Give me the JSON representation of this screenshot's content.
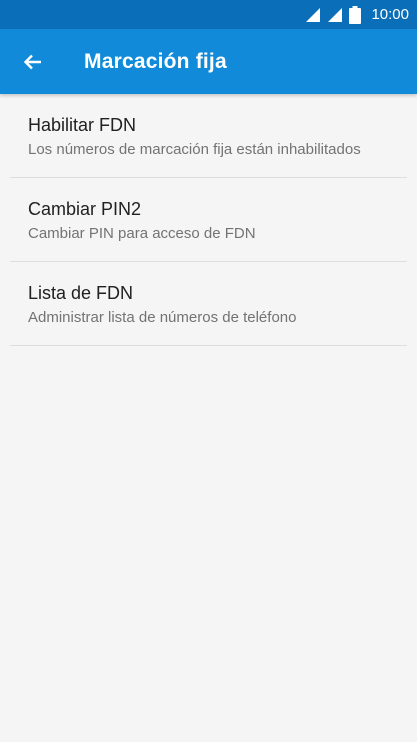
{
  "status_bar": {
    "time": "10:00",
    "icons": [
      "signal-icon",
      "signal-icon",
      "battery-icon"
    ]
  },
  "app_bar": {
    "title": "Marcación fija",
    "back_icon": "arrow-left-icon"
  },
  "items": [
    {
      "title": "Habilitar FDN",
      "subtitle": "Los números de marcación fija están inhabilitados"
    },
    {
      "title": "Cambiar PIN2",
      "subtitle": "Cambiar PIN para acceso de FDN"
    },
    {
      "title": "Lista de FDN",
      "subtitle": "Administrar lista de números de teléfono"
    }
  ],
  "colors": {
    "status_bar": "#0a6fb8",
    "app_bar": "#118bd9",
    "background": "#f5f5f5",
    "title_text": "#212121",
    "subtitle_text": "#737373"
  }
}
